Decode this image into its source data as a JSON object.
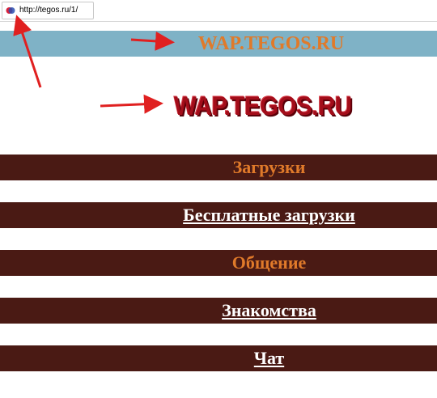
{
  "address_bar": {
    "url": "http://tegos.ru/1/",
    "favicon": "browser-favicon-icon"
  },
  "header": {
    "title": "WAP.TEGOS.RU",
    "background_color": "#7fb2c6",
    "title_color": "#e07a2a"
  },
  "logo": {
    "text": "WAP.TEGOS.RU",
    "color": "#a30d1a"
  },
  "menu": {
    "bar_color": "#4a1a14",
    "items": [
      {
        "label": "Загрузки",
        "style": "heading",
        "color": "#e07a2a"
      },
      {
        "label": "Бесплатные загрузки",
        "style": "link",
        "color": "#ffffff"
      },
      {
        "label": "Общение",
        "style": "heading",
        "color": "#e07a2a"
      },
      {
        "label": "Знакомства",
        "style": "link",
        "color": "#ffffff"
      },
      {
        "label": "Чат",
        "style": "link",
        "color": "#ffffff"
      }
    ]
  },
  "annotations": {
    "arrow_color": "#e02020",
    "icons": [
      "red-arrow-icon"
    ]
  }
}
